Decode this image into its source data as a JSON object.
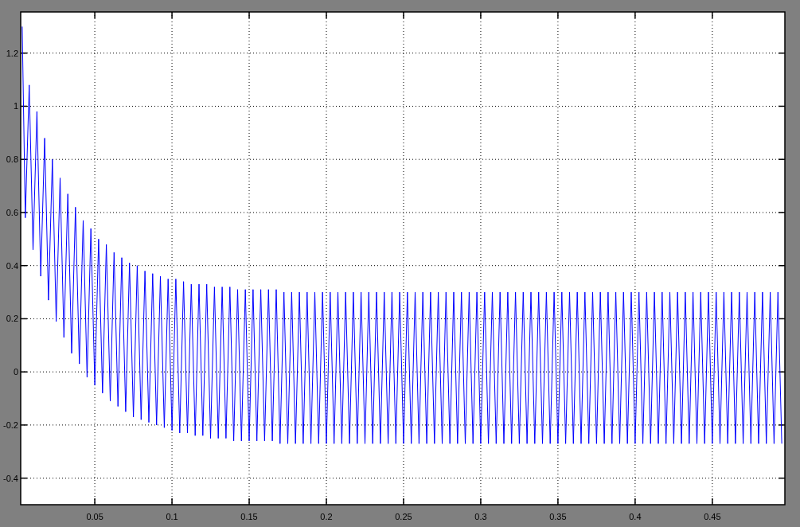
{
  "figure": {
    "axes": {
      "chart_data": {
        "type": "line",
        "xlim": [
          0.002,
          0.497
        ],
        "ylim": [
          -0.5,
          1.355
        ],
        "grid": true,
        "xticks": [
          {
            "value": 0.05,
            "label": "0.05"
          },
          {
            "value": 0.1,
            "label": "0.1"
          },
          {
            "value": 0.15,
            "label": "0.15"
          },
          {
            "value": 0.2,
            "label": "0.2"
          },
          {
            "value": 0.25,
            "label": "0.25"
          },
          {
            "value": 0.3,
            "label": "0.3"
          },
          {
            "value": 0.35,
            "label": "0.35"
          },
          {
            "value": 0.4,
            "label": "0.4"
          },
          {
            "value": 0.45,
            "label": "0.45"
          }
        ],
        "yticks": [
          -0.4,
          -0.2,
          0,
          0.2,
          0.4,
          0.6,
          0.8,
          1,
          1.2
        ],
        "x": [
          0.003,
          0.005,
          0.0075,
          0.01,
          0.0125,
          0.015,
          0.0175,
          0.02,
          0.0225,
          0.025,
          0.0275,
          0.03,
          0.0325,
          0.035,
          0.0375,
          0.04,
          0.0425,
          0.045,
          0.0475,
          0.05,
          0.0525,
          0.055,
          0.0575,
          0.06,
          0.0625,
          0.065,
          0.0675,
          0.07,
          0.0725,
          0.075,
          0.0775,
          0.08,
          0.0825,
          0.085,
          0.0875,
          0.09,
          0.0925,
          0.095,
          0.0975,
          0.1,
          0.1025,
          0.105,
          0.1075,
          0.11,
          0.1125,
          0.115,
          0.1175,
          0.12,
          0.1225,
          0.125,
          0.1275,
          0.13,
          0.1325,
          0.135,
          0.1375,
          0.14,
          0.1425,
          0.145,
          0.1475,
          0.15,
          0.1525,
          0.155,
          0.1575,
          0.16,
          0.1625,
          0.165,
          0.1675,
          0.17,
          0.1725,
          0.175,
          0.1775,
          0.18,
          0.1825,
          0.185,
          0.1875,
          0.19,
          0.1925,
          0.195,
          0.1975,
          0.2,
          0.2025,
          0.205,
          0.2075,
          0.21,
          0.2125,
          0.215,
          0.2175,
          0.22,
          0.2225,
          0.225,
          0.2275,
          0.23,
          0.2325,
          0.235,
          0.2375,
          0.24,
          0.2425,
          0.245,
          0.2475,
          0.25,
          0.2525,
          0.255,
          0.2575,
          0.26,
          0.2625,
          0.265,
          0.2675,
          0.27,
          0.2725,
          0.275,
          0.2775,
          0.28,
          0.2825,
          0.285,
          0.2875,
          0.29,
          0.2925,
          0.295,
          0.2975,
          0.3,
          0.3025,
          0.305,
          0.3075,
          0.31,
          0.3125,
          0.315,
          0.3175,
          0.32,
          0.3225,
          0.325,
          0.3275,
          0.33,
          0.3325,
          0.335,
          0.3375,
          0.34,
          0.3425,
          0.345,
          0.3475,
          0.35,
          0.3525,
          0.355,
          0.3575,
          0.36,
          0.3625,
          0.365,
          0.3675,
          0.37,
          0.3725,
          0.375,
          0.3775,
          0.38,
          0.3825,
          0.385,
          0.3875,
          0.39,
          0.3925,
          0.395,
          0.3975,
          0.4,
          0.4025,
          0.405,
          0.4075,
          0.41,
          0.4125,
          0.415,
          0.4175,
          0.42,
          0.4225,
          0.425,
          0.4275,
          0.43,
          0.4325,
          0.435,
          0.4375,
          0.44,
          0.4425,
          0.445,
          0.4475,
          0.45,
          0.4525,
          0.455,
          0.4575,
          0.46,
          0.4625,
          0.465,
          0.4675,
          0.47,
          0.4725,
          0.475,
          0.4775,
          0.48,
          0.4825,
          0.485,
          0.4875,
          0.49,
          0.4925,
          0.495
        ],
        "series": [
          {
            "color": "#0000ff",
            "values": [
              1.3,
              0.58,
              1.08,
              0.46,
              0.98,
              0.36,
              0.88,
              0.27,
              0.8,
              0.19,
              0.73,
              0.13,
              0.67,
              0.07,
              0.62,
              0.03,
              0.57,
              -0.02,
              0.54,
              -0.05,
              0.5,
              -0.08,
              0.48,
              -0.11,
              0.45,
              -0.13,
              0.43,
              -0.15,
              0.41,
              -0.17,
              0.4,
              -0.18,
              0.38,
              -0.19,
              0.37,
              -0.2,
              0.36,
              -0.21,
              0.35,
              -0.22,
              0.35,
              -0.23,
              0.34,
              -0.23,
              0.33,
              -0.24,
              0.33,
              -0.24,
              0.33,
              -0.25,
              0.32,
              -0.25,
              0.32,
              -0.25,
              0.32,
              -0.26,
              0.31,
              -0.26,
              0.31,
              -0.26,
              0.31,
              -0.26,
              0.31,
              -0.26,
              0.31,
              -0.26,
              0.31,
              -0.27,
              0.3,
              -0.27,
              0.3,
              -0.27,
              0.3,
              -0.27,
              0.3,
              -0.27,
              0.3,
              -0.27,
              0.3,
              -0.27,
              0.3,
              -0.27,
              0.3,
              -0.27,
              0.3,
              -0.27,
              0.3,
              -0.27,
              0.3,
              -0.27,
              0.3,
              -0.27,
              0.3,
              -0.27,
              0.3,
              -0.27,
              0.3,
              -0.27,
              0.3,
              -0.27,
              0.3,
              -0.27,
              0.3,
              -0.27,
              0.3,
              -0.27,
              0.3,
              -0.27,
              0.3,
              -0.27,
              0.3,
              -0.27,
              0.3,
              -0.27,
              0.3,
              -0.27,
              0.3,
              -0.27,
              0.3,
              -0.27,
              0.3,
              -0.27,
              0.3,
              -0.27,
              0.3,
              -0.27,
              0.3,
              -0.27,
              0.3,
              -0.27,
              0.3,
              -0.27,
              0.3,
              -0.27,
              0.3,
              -0.27,
              0.3,
              -0.27,
              0.3,
              -0.27,
              0.3,
              -0.27,
              0.3,
              -0.27,
              0.3,
              -0.27,
              0.3,
              -0.27,
              0.3,
              -0.27,
              0.3,
              -0.27,
              0.3,
              -0.27,
              0.3,
              -0.27,
              0.3,
              -0.27,
              0.3,
              -0.27,
              0.3,
              -0.27,
              0.3,
              -0.27,
              0.3,
              -0.27,
              0.3,
              -0.27,
              0.3,
              -0.27,
              0.3,
              -0.27,
              0.3,
              -0.27,
              0.3,
              -0.27,
              0.3,
              -0.27,
              0.3,
              -0.27,
              0.3,
              -0.27,
              0.3,
              -0.27,
              0.3,
              -0.27,
              0.3,
              -0.27,
              0.3,
              -0.27,
              0.3,
              -0.27,
              0.3,
              -0.27,
              0.3,
              -0.27,
              0.3,
              -0.27
            ]
          }
        ]
      }
    }
  }
}
